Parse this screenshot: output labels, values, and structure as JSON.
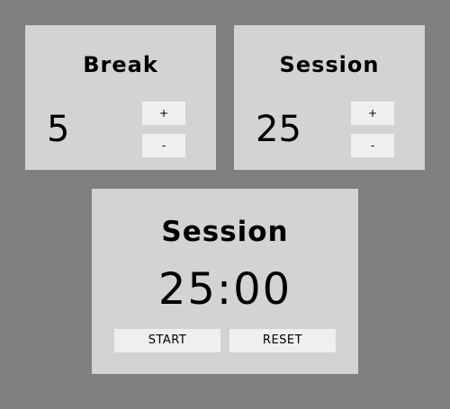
{
  "break": {
    "title": "Break",
    "value": "5",
    "increment_label": "+",
    "decrement_label": "-"
  },
  "session": {
    "title": "Session",
    "value": "25",
    "increment_label": "+",
    "decrement_label": "-"
  },
  "timer": {
    "label": "Session",
    "time": "25:00",
    "start_label": "START",
    "reset_label": "RESET"
  },
  "colors": {
    "background": "#808080",
    "panel": "#d3d3d3",
    "button": "#efefef",
    "text": "#000000"
  }
}
